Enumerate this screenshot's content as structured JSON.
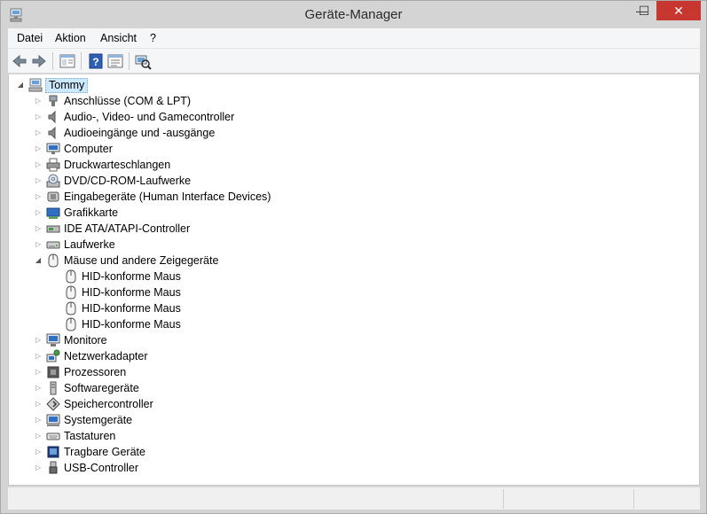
{
  "window": {
    "title": "Geräte-Manager",
    "minimize_glyph": "—",
    "maximize_glyph": "☐",
    "close_glyph": "✕"
  },
  "menu": [
    "Datei",
    "Aktion",
    "Ansicht",
    "?"
  ],
  "toolbar": {
    "buttons": [
      "back-arrow-icon",
      "forward-arrow-icon",
      "show-hide-console-tree-icon",
      "help-icon",
      "properties-icon",
      "scan-hardware-icon"
    ]
  },
  "tree": {
    "root": "Tommy",
    "categories": [
      {
        "label": "Anschlüsse (COM & LPT)",
        "icon": "port-icon",
        "expanded": false
      },
      {
        "label": "Audio-, Video- und Gamecontroller",
        "icon": "speaker-icon",
        "expanded": false
      },
      {
        "label": "Audioeingänge und -ausgänge",
        "icon": "speaker-icon",
        "expanded": false
      },
      {
        "label": "Computer",
        "icon": "computer-icon",
        "expanded": false
      },
      {
        "label": "Druckwarteschlangen",
        "icon": "printer-icon",
        "expanded": false
      },
      {
        "label": "DVD/CD-ROM-Laufwerke",
        "icon": "disc-drive-icon",
        "expanded": false
      },
      {
        "label": "Eingabegeräte (Human Interface Devices)",
        "icon": "hid-icon",
        "expanded": false
      },
      {
        "label": "Grafikkarte",
        "icon": "display-adapter-icon",
        "expanded": false
      },
      {
        "label": "IDE ATA/ATAPI-Controller",
        "icon": "ide-controller-icon",
        "expanded": false
      },
      {
        "label": "Laufwerke",
        "icon": "disk-drive-icon",
        "expanded": false
      },
      {
        "label": "Mäuse und andere Zeigegeräte",
        "icon": "mouse-icon",
        "expanded": true,
        "children": [
          "HID-konforme Maus",
          "HID-konforme Maus",
          "HID-konforme Maus",
          "HID-konforme Maus"
        ]
      },
      {
        "label": "Monitore",
        "icon": "monitor-icon",
        "expanded": false
      },
      {
        "label": "Netzwerkadapter",
        "icon": "network-adapter-icon",
        "expanded": false
      },
      {
        "label": "Prozessoren",
        "icon": "processor-icon",
        "expanded": false
      },
      {
        "label": "Softwaregeräte",
        "icon": "software-device-icon",
        "expanded": false
      },
      {
        "label": "Speichercontroller",
        "icon": "storage-controller-icon",
        "expanded": false
      },
      {
        "label": "Systemgeräte",
        "icon": "system-device-icon",
        "expanded": false
      },
      {
        "label": "Tastaturen",
        "icon": "keyboard-icon",
        "expanded": false
      },
      {
        "label": "Tragbare Geräte",
        "icon": "portable-device-icon",
        "expanded": false
      },
      {
        "label": "USB-Controller",
        "icon": "usb-icon",
        "expanded": false
      }
    ]
  },
  "colors": {
    "selection": "#cce8ff",
    "close_button": "#c7372f",
    "chrome": "#d4d4d4"
  }
}
